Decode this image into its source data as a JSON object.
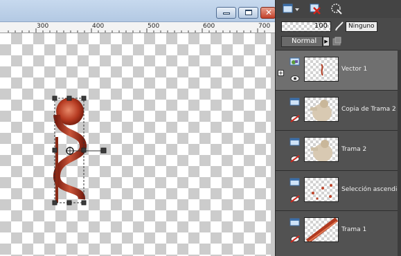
{
  "window": {
    "minimize_icon": "minimize-icon",
    "maximize_icon": "maximize-icon",
    "close_glyph": "✕"
  },
  "ruler": {
    "labels": [
      "300",
      "400",
      "500",
      "600",
      "700"
    ]
  },
  "colors": {
    "canvas_bg": "#dcdcdc",
    "panel_bg": "#525252",
    "selected_layer": "#6f6f6f",
    "object_red": "#b13a20",
    "handle": "#2f2f2f"
  },
  "layers_panel": {
    "toolbar_icons": [
      "new-layer-icon",
      "dropdown-arrow-icon",
      "delete-layer-icon",
      "selection-icon"
    ],
    "opacity": "100",
    "mask_value": "Ninguno",
    "blend_mode": "Normal",
    "layers": [
      {
        "name": "Vector 1",
        "selected": true,
        "type": "vector"
      },
      {
        "name": "Copia de Trama 2",
        "selected": false,
        "type": "raster"
      },
      {
        "name": "Trama 2",
        "selected": false,
        "type": "raster"
      },
      {
        "name": "Selección ascendida",
        "selected": false,
        "type": "raster"
      },
      {
        "name": "Trama 1",
        "selected": false,
        "type": "raster"
      }
    ]
  }
}
